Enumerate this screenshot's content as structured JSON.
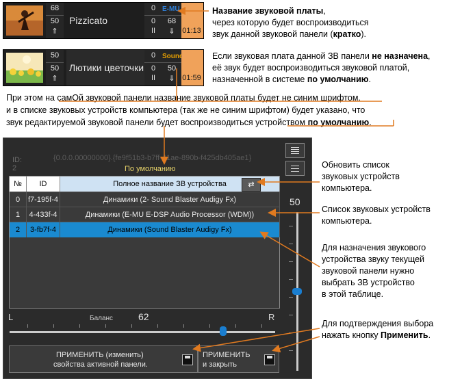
{
  "panel1": {
    "vol": "68",
    "vol_sub": "50",
    "name": "Pizzicato",
    "right_top": "0",
    "device": "E-MU",
    "right_sub": "0",
    "right_sub2": "68",
    "time": "01:13",
    "pause": "II",
    "up": "⇑",
    "down": "⇓"
  },
  "panel2": {
    "vol": "50",
    "vol_sub": "50",
    "name": "Лютики цветочки",
    "right_top": "0",
    "device": "Sound",
    "right_sub": "0",
    "right_sub2": "50",
    "time": "01:59",
    "pause": "II",
    "up": "⇑",
    "down": "⇓"
  },
  "notes": {
    "n1_bold": "Название звуковой платы",
    "n1_comma": ",",
    "n1_l2": "через которую будет воспроизводиться",
    "n1_l3_a": "звук данной звуковой панели (",
    "n1_l3_b": "кратко",
    "n1_l3_c": ").",
    "n2_l1_a": "Если звуковая плата данной ЗВ панели ",
    "n2_l1_b": "не назначена",
    "n2_l1_c": ",",
    "n2_l2": "её звук будет воспроизводиться звуковой платой,",
    "n2_l3_a": "назначенной в системе ",
    "n2_l3_b": "по умолчанию",
    "n2_l3_c": ".",
    "n3_l1": "При этом на самОй звуковой панели название звуковой платы будет не синим шрифтом.",
    "n3_l2": "и в списке звуковых устройств компьютера (так же не синим шрифтом) будет указано, что",
    "n3_l3_a": "звук редактируемой звуковой панели будет воспроизводиться устройством ",
    "n3_l3_b": "по умолчанию",
    "n3_l3_c": ".",
    "r1": [
      "Обновить список",
      "звуковых устройств",
      "компьютера."
    ],
    "r2": [
      "Список звуковых устройств",
      "компьютера."
    ],
    "r3": [
      "Для назначения  звукового",
      "устройства звуку текущей",
      "звуковой панели нужно",
      "выбрать ЗВ устройство",
      "в этой таблице."
    ],
    "r4_l1": "Для подтверждения выбора",
    "r4_l2_a": "нажать  кнопку ",
    "r4_l2_b": "Применить",
    "r4_l2_c": "."
  },
  "dialog": {
    "id_label": "ID:",
    "id_value": "2",
    "guid": "{0.0.0.00000000}.{fe9f51b3-b7ff-41ae-890b-f425db405ae1}",
    "default_label": "По умолчанию",
    "table": {
      "headers": {
        "num": "№",
        "id": "ID",
        "name": "Полное название ЗВ устройства"
      },
      "refresh_icon": "refresh-icon",
      "rows": [
        {
          "num": "0",
          "id": "f7-195f-4",
          "name": "Динамики (2- Sound Blaster Audigy Fx)"
        },
        {
          "num": "1",
          "id": "4-433f-4",
          "name": "Динамики (E-MU E-DSP Audio Processor (WDM))"
        },
        {
          "num": "2",
          "id": "3-fb7f-4",
          "name": "Динамики (Sound Blaster Audigy Fx)"
        }
      ]
    },
    "volume": "50",
    "balance": {
      "left": "L",
      "right": "R",
      "label": "Баланс",
      "value": "62"
    },
    "apply_active": {
      "l1": "ПРИМЕНИТЬ   (изменить)",
      "l2": "свойства активной панели."
    },
    "apply_close": {
      "l1": "ПРИМЕНИТЬ",
      "l2": "и закрыть"
    }
  },
  "colors": {
    "selected": "#1a8ad0",
    "device_blue": "#2f7fd8",
    "orange": "#f0a25a",
    "arrow": "#e07a20"
  }
}
